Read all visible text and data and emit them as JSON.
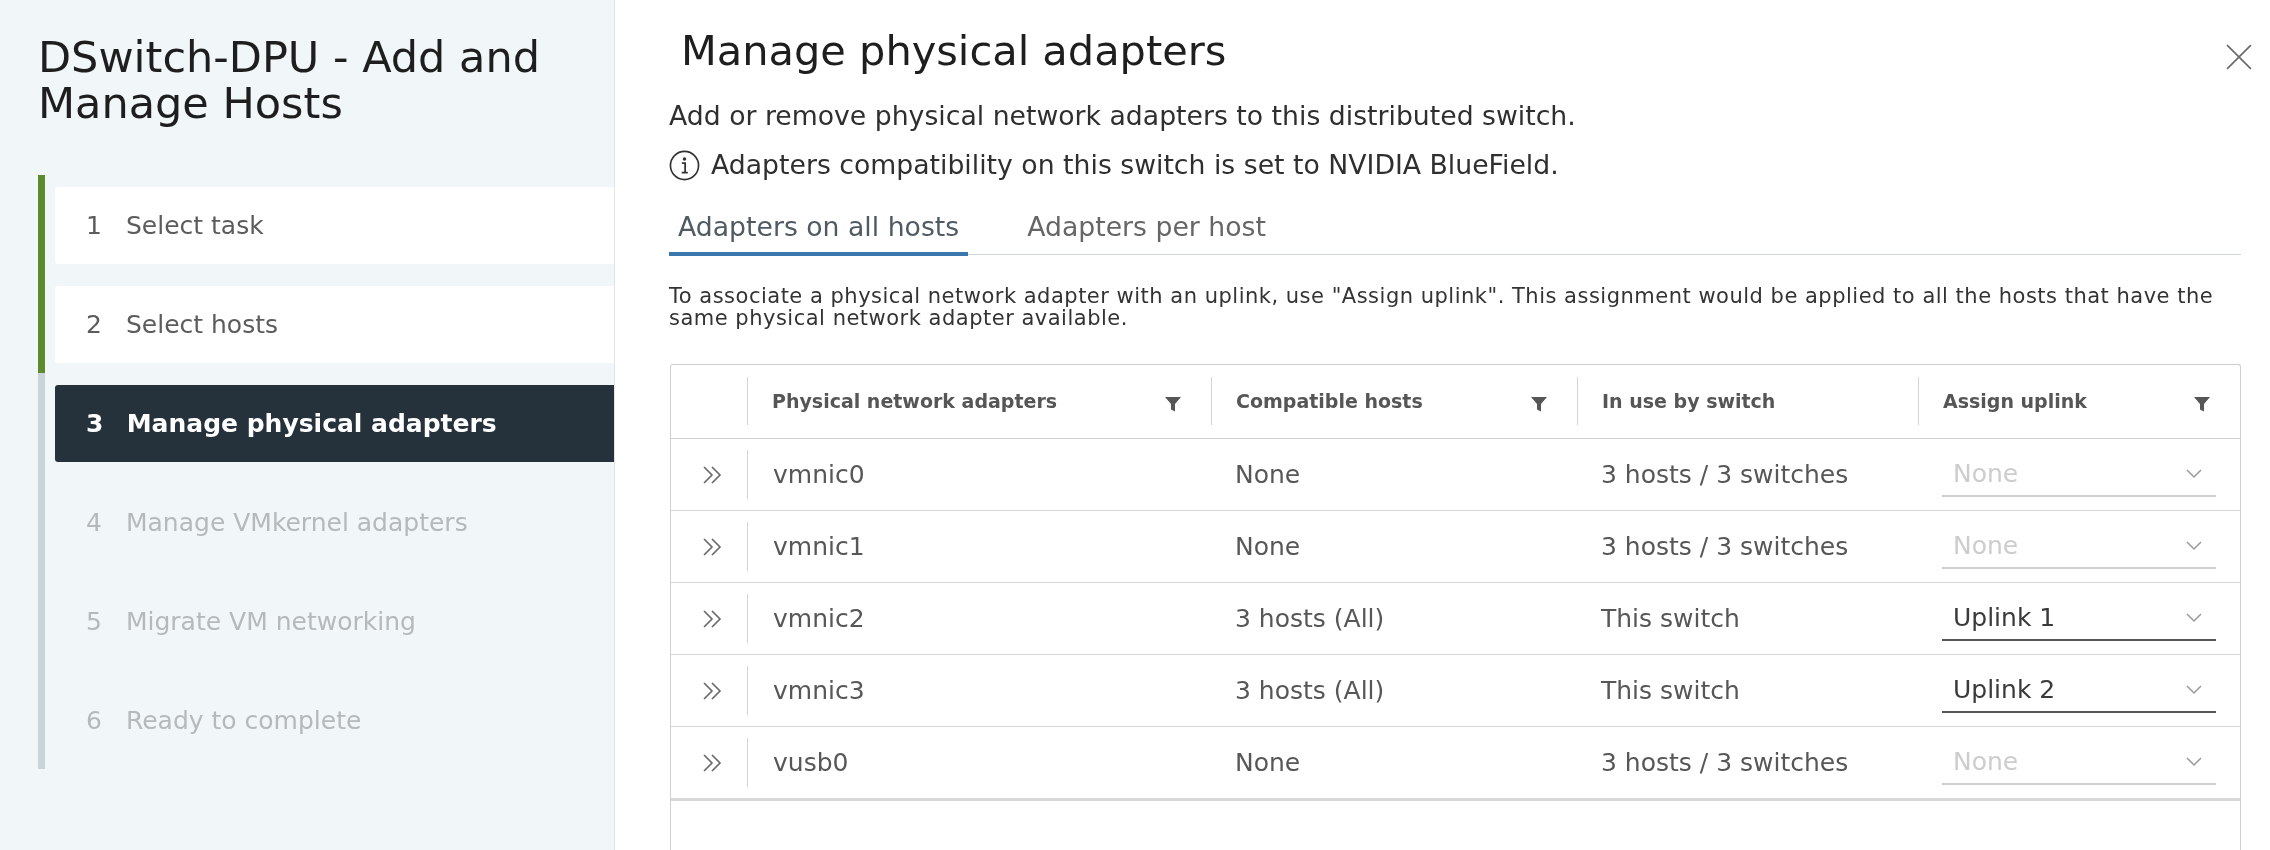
{
  "sidebar": {
    "title": "DSwitch-DPU - Add and Manage Hosts",
    "steps": [
      {
        "number": "1",
        "label": "Select task",
        "completed": true,
        "selected": false
      },
      {
        "number": "2",
        "label": "Select hosts",
        "completed": true,
        "selected": false
      },
      {
        "number": "3",
        "label": "Manage physical adapters",
        "completed": false,
        "selected": true
      },
      {
        "number": "4",
        "label": "Manage VMkernel adapters",
        "completed": false,
        "selected": false
      },
      {
        "number": "5",
        "label": "Migrate VM networking",
        "completed": false,
        "selected": false
      },
      {
        "number": "6",
        "label": "Ready to complete",
        "completed": false,
        "selected": false
      }
    ]
  },
  "dialog": {
    "title": "Manage physical adapters",
    "subtitle": "Add or remove physical network adapters to this distributed switch.",
    "notice": "Adapters compatibility on this switch is set to NVIDIA BlueField.",
    "tabs": [
      {
        "label": "Adapters on all hosts",
        "selected": true
      },
      {
        "label": "Adapters per host",
        "selected": false
      }
    ],
    "hint": "To associate a physical network adapter with an uplink, use \"Assign uplink\". This assignment would be applied to all the hosts that have the same physical network adapter available.",
    "table": {
      "columns": [
        {
          "label": "Physical network adapters",
          "filter": true
        },
        {
          "label": "Compatible hosts",
          "filter": true
        },
        {
          "label": "In use by switch",
          "filter": false
        },
        {
          "label": "Assign uplink",
          "filter": true
        }
      ],
      "rows": [
        {
          "adapter": "vmnic0",
          "compatible_hosts": "None",
          "in_use_by_switch": "3 hosts / 3 switches",
          "uplink": {
            "value": "None",
            "disabled": true
          }
        },
        {
          "adapter": "vmnic1",
          "compatible_hosts": "None",
          "in_use_by_switch": "3 hosts / 3 switches",
          "uplink": {
            "value": "None",
            "disabled": true
          }
        },
        {
          "adapter": "vmnic2",
          "compatible_hosts": "3 hosts (All)",
          "in_use_by_switch": "This switch",
          "uplink": {
            "value": "Uplink 1",
            "disabled": false
          }
        },
        {
          "adapter": "vmnic3",
          "compatible_hosts": "3 hosts (All)",
          "in_use_by_switch": "This switch",
          "uplink": {
            "value": "Uplink 2",
            "disabled": false
          }
        },
        {
          "adapter": "vusb0",
          "compatible_hosts": "None",
          "in_use_by_switch": "3 hosts / 3 switches",
          "uplink": {
            "value": "None",
            "disabled": true
          }
        }
      ]
    }
  }
}
